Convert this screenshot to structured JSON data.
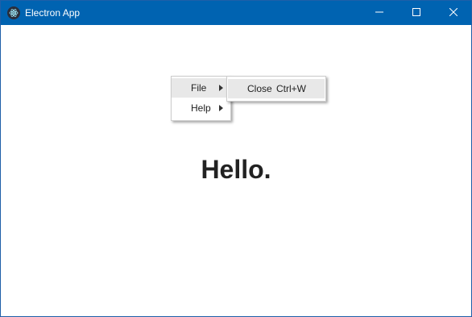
{
  "window": {
    "title": "Electron App",
    "icon": "electron-logo-icon",
    "controls": {
      "minimize_icon": "minimize-icon",
      "maximize_icon": "maximize-icon",
      "close_icon": "close-icon"
    }
  },
  "colors": {
    "titlebar": "#0063b1",
    "menu_highlight": "#e8e8e8"
  },
  "context_menu": {
    "items": [
      {
        "label": "File",
        "has_submenu": true,
        "highlighted": true
      },
      {
        "label": "Help",
        "has_submenu": true,
        "highlighted": false
      }
    ],
    "submenu": {
      "items": [
        {
          "label": "Close",
          "accelerator": "Ctrl+W",
          "highlighted": true
        }
      ]
    }
  },
  "content": {
    "heading": "Hello."
  }
}
